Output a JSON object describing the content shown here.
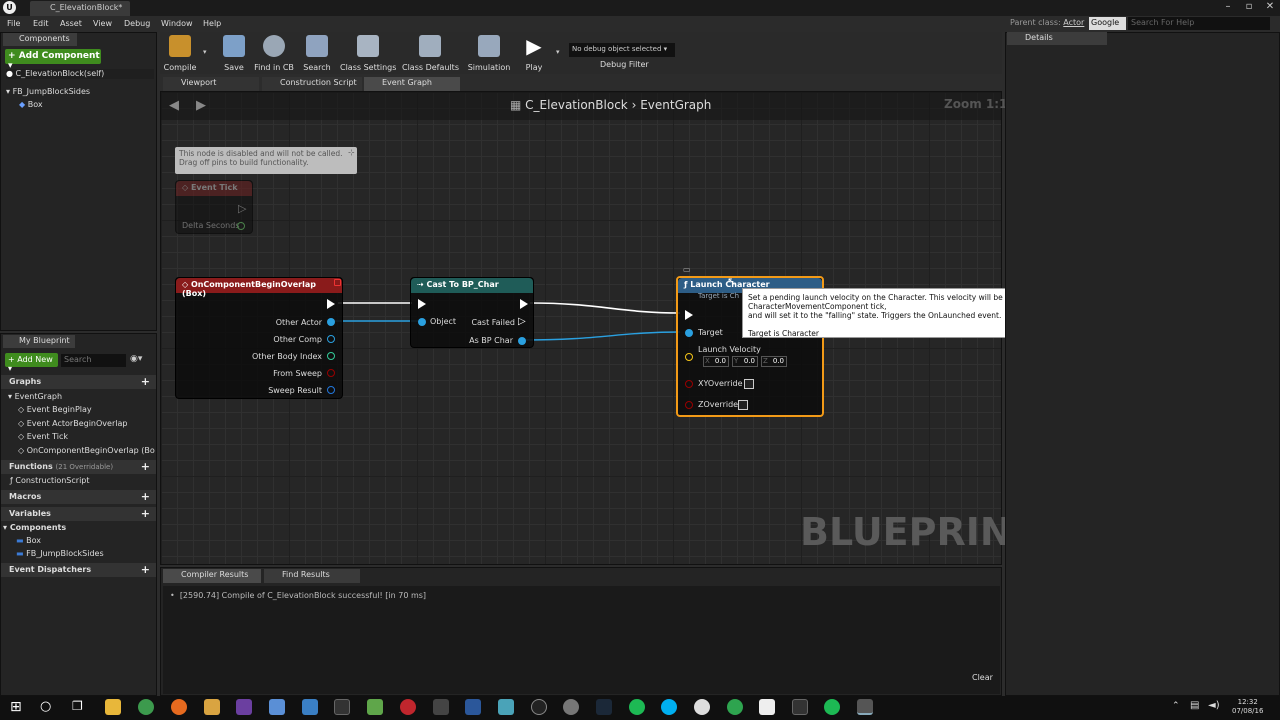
{
  "titlebar": {
    "doc_tab": "C_ElevationBlock*"
  },
  "menu": [
    "File",
    "Edit",
    "Asset",
    "View",
    "Debug",
    "Window",
    "Help"
  ],
  "parent_class": {
    "label": "Parent class:",
    "value": "Actor"
  },
  "help": {
    "source": "Google",
    "placeholder": "Search For Help"
  },
  "components": {
    "tab": "Components",
    "add_label": "Add Component",
    "root": "C_ElevationBlock(self)",
    "child": "FB_JumpBlockSides",
    "leaf": "Box"
  },
  "toolbar": {
    "items": [
      "Compile",
      "Save",
      "Find in CB",
      "Search",
      "Class Settings",
      "Class Defaults",
      "Simulation",
      "Play"
    ],
    "debug_object": "No debug object selected",
    "debug_filter": "Debug Filter"
  },
  "graph_tabs": [
    "Viewport",
    "Construction Script",
    "Event Graph"
  ],
  "breadcrumb": {
    "blueprint": "C_ElevationBlock",
    "graph": "EventGraph",
    "zoom": "Zoom 1:1",
    "watermark": "BLUEPRINT"
  },
  "disabled_comment": {
    "line1": "This node is disabled and will not be called.",
    "line2": "Drag off pins to build functionality."
  },
  "event_tick": {
    "title": "Event Tick",
    "pin": "Delta Seconds"
  },
  "overlap_node": {
    "title": "OnComponentBeginOverlap (Box)",
    "pins": [
      "Other Actor",
      "Other Comp",
      "Other Body Index",
      "From Sweep",
      "Sweep Result"
    ]
  },
  "cast_node": {
    "title": "Cast To BP_Char",
    "object": "Object",
    "failed": "Cast Failed",
    "as": "As BP Char"
  },
  "launch_node": {
    "title": "Launch Character",
    "subtitle": "Target is Ch",
    "target": "Target",
    "velocity": "Launch Velocity",
    "x": "0.0",
    "y": "0.0",
    "z": "0.0",
    "xy": "XYOverride",
    "zo": "ZOverride"
  },
  "tooltip": {
    "line1": "Set a pending launch velocity on the Character. This velocity will be processed on the next CharacterMovementComponent tick,",
    "line2": "and will set it to the \"falling\" state. Triggers the OnLaunched event.",
    "line3": "Target is Character"
  },
  "my_blueprint": {
    "tab": "My Blueprint",
    "add_new": "Add New",
    "search_placeholder": "Search",
    "graphs": "Graphs",
    "graph_name": "EventGraph",
    "events": [
      "Event BeginPlay",
      "Event ActorBeginOverlap",
      "Event Tick",
      "OnComponentBeginOverlap (Bo"
    ],
    "functions": "Functions",
    "functions_note": "(21 Overridable)",
    "construction": "ConstructionScript",
    "macros": "Macros",
    "variables": "Variables",
    "components": "Components",
    "comp_items": [
      "Box",
      "FB_JumpBlockSides"
    ],
    "dispatchers": "Event Dispatchers"
  },
  "bottom": {
    "tab1": "Compiler Results",
    "tab2": "Find Results",
    "log": "[2590.74] Compile of C_ElevationBlock successful! [in 70 ms]",
    "clear": "Clear"
  },
  "details": {
    "tab": "Details"
  },
  "clock": {
    "time": "12:32",
    "date": "07/08/16"
  }
}
